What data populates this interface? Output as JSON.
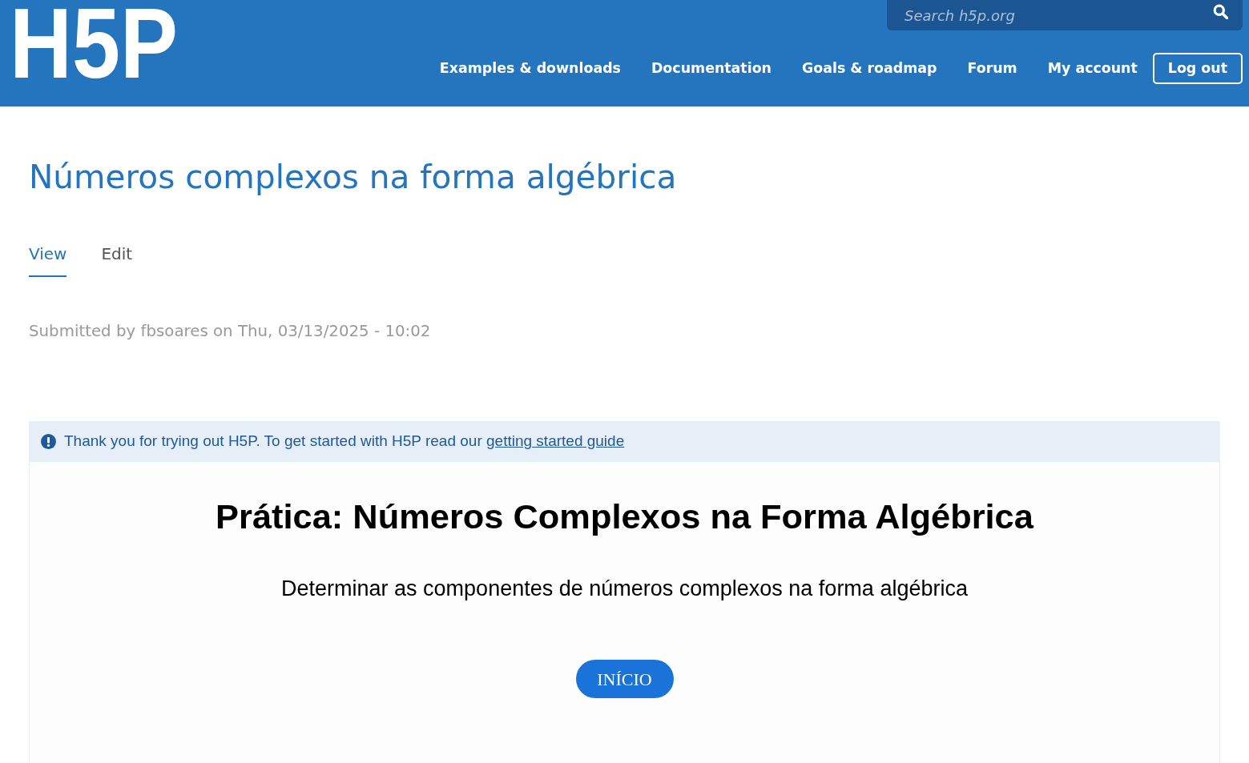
{
  "header": {
    "logo": "H5P",
    "search": {
      "placeholder": "Search h5p.org"
    },
    "nav": [
      {
        "label": "Examples & downloads",
        "kind": "link"
      },
      {
        "label": "Documentation",
        "kind": "link"
      },
      {
        "label": "Goals & roadmap",
        "kind": "link"
      },
      {
        "label": "Forum",
        "kind": "link"
      },
      {
        "label": "My account",
        "kind": "link"
      },
      {
        "label": "Log out",
        "kind": "button"
      }
    ]
  },
  "page": {
    "title": "Números complexos na forma algébrica",
    "tabs": [
      {
        "label": "View",
        "selected": true
      },
      {
        "label": "Edit",
        "selected": false
      }
    ],
    "submitted": "Submitted by fbsoares on Thu, 03/13/2025 - 10:02"
  },
  "notice": {
    "text": "Thank you for trying out H5P. To get started with H5P read our",
    "link": "getting started guide"
  },
  "content": {
    "heading": "Prática: Números Complexos na Forma Algébrica",
    "subtitle": "Determinar as componentes de números complexos na forma algébrica",
    "start_button": "INÍCIO"
  }
}
